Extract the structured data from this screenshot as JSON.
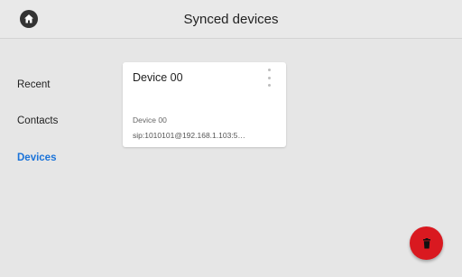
{
  "header": {
    "title": "Synced devices",
    "home_icon": "home-icon"
  },
  "sidebar": {
    "items": [
      {
        "label": "Recent",
        "active": false
      },
      {
        "label": "Contacts",
        "active": false
      },
      {
        "label": "Devices",
        "active": true
      }
    ]
  },
  "device_card": {
    "title": "Device 00",
    "name": "Device 00",
    "address": "sip:1010101@192.168.1.103:5…",
    "menu_icon": "more-vertical-icon"
  },
  "fab": {
    "icon": "delete-icon",
    "color": "#d91920"
  },
  "colors": {
    "accent": "#1a73d9",
    "background": "#e6e6e6"
  }
}
